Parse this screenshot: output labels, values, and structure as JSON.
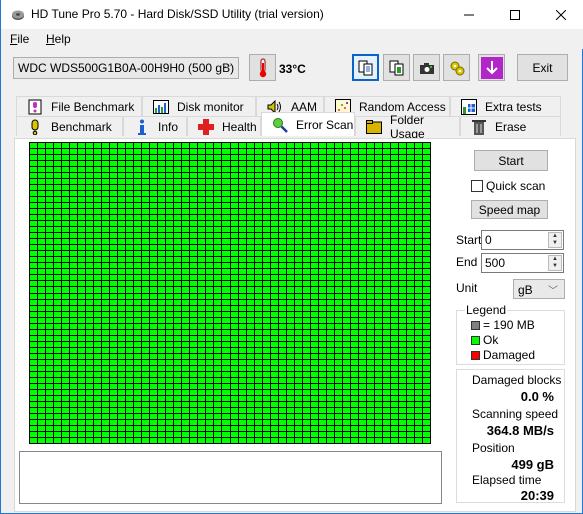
{
  "window": {
    "title": "HD Tune Pro 5.70 - Hard Disk/SSD Utility (trial version)",
    "controls": {
      "minimize": "—",
      "maximize": "☐",
      "close": "✕"
    }
  },
  "menu": [
    {
      "label": "File",
      "accel": "F",
      "rest": "ile"
    },
    {
      "label": "Help",
      "accel": "H",
      "rest": "elp"
    }
  ],
  "toolbar": {
    "drive": "WDC WDS500G1B0A-00H9H0 (500 gB)",
    "temperature": "33°C",
    "exit_label": "Exit",
    "icons": [
      "copy-text-icon",
      "copy-screenshot-icon",
      "camera-icon",
      "options-icon",
      "save-down-icon"
    ]
  },
  "tabs": {
    "top_row": [
      {
        "label": "File Benchmark",
        "icon": "file-benchmark-icon"
      },
      {
        "label": "Disk monitor",
        "icon": "disk-monitor-icon"
      },
      {
        "label": "AAM",
        "icon": "speaker-icon"
      },
      {
        "label": "Random Access",
        "icon": "random-access-icon"
      },
      {
        "label": "Extra tests",
        "icon": "extra-tests-icon"
      }
    ],
    "bottom_row": [
      {
        "label": "Benchmark",
        "icon": "benchmark-icon"
      },
      {
        "label": "Info",
        "icon": "info-icon"
      },
      {
        "label": "Health",
        "icon": "health-icon"
      },
      {
        "label": "Error Scan",
        "icon": "magnifier-icon",
        "active": true
      },
      {
        "label": "Folder Usage",
        "icon": "folder-icon"
      },
      {
        "label": "Erase",
        "icon": "trash-icon"
      }
    ]
  },
  "scan": {
    "grid": {
      "columns": 50,
      "rows": 50,
      "block_color": "#00ff00",
      "border_color": "#000000"
    },
    "start_button": "Start",
    "quick_scan_label": "Quick scan",
    "quick_scan_checked": false,
    "speed_map_button": "Speed map",
    "start_label": "Start",
    "start_value": "0",
    "end_label": "End",
    "end_value": "500",
    "unit_label": "Unit",
    "unit_value": "gB",
    "legend": {
      "title": "Legend",
      "items": [
        {
          "label": "= 190 MB",
          "color": "#808080"
        },
        {
          "label": "Ok",
          "color": "#00ff00"
        },
        {
          "label": "Damaged",
          "color": "#ff0000"
        }
      ]
    },
    "stats": {
      "damaged_blocks_label": "Damaged blocks",
      "damaged_blocks_value": "0.0 %",
      "scanning_speed_label": "Scanning speed",
      "scanning_speed_value": "364.8 MB/s",
      "position_label": "Position",
      "position_value": "499 gB",
      "elapsed_label": "Elapsed time",
      "elapsed_value": "20:39"
    }
  }
}
